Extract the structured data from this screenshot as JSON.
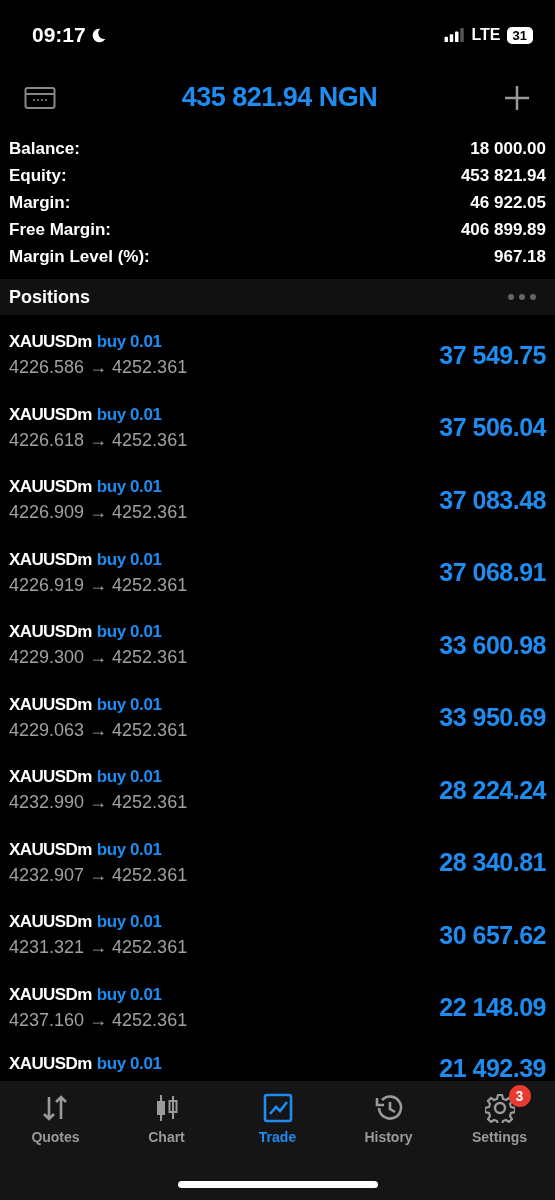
{
  "status_bar": {
    "time": "09:17",
    "network": "LTE",
    "battery": "31"
  },
  "header": {
    "title": "435 821.94 NGN"
  },
  "summary": [
    {
      "label": "Balance:",
      "value": "18 000.00"
    },
    {
      "label": "Equity:",
      "value": "453 821.94"
    },
    {
      "label": "Margin:",
      "value": "46 922.05"
    },
    {
      "label": "Free Margin:",
      "value": "406 899.89"
    },
    {
      "label": "Margin Level (%):",
      "value": "967.18"
    }
  ],
  "positions_header": {
    "title": "Positions"
  },
  "positions": [
    {
      "symbol": "XAUUSDm",
      "order": "buy 0.01",
      "prices": "4226.586 → 4252.361",
      "profit": "37 549.75"
    },
    {
      "symbol": "XAUUSDm",
      "order": "buy 0.01",
      "prices": "4226.618 → 4252.361",
      "profit": "37 506.04"
    },
    {
      "symbol": "XAUUSDm",
      "order": "buy 0.01",
      "prices": "4226.909 → 4252.361",
      "profit": "37 083.48"
    },
    {
      "symbol": "XAUUSDm",
      "order": "buy 0.01",
      "prices": "4226.919 → 4252.361",
      "profit": "37 068.91"
    },
    {
      "symbol": "XAUUSDm",
      "order": "buy 0.01",
      "prices": "4229.300 → 4252.361",
      "profit": "33 600.98"
    },
    {
      "symbol": "XAUUSDm",
      "order": "buy 0.01",
      "prices": "4229.063 → 4252.361",
      "profit": "33 950.69"
    },
    {
      "symbol": "XAUUSDm",
      "order": "buy 0.01",
      "prices": "4232.990 → 4252.361",
      "profit": "28 224.24"
    },
    {
      "symbol": "XAUUSDm",
      "order": "buy 0.01",
      "prices": "4232.907 → 4252.361",
      "profit": "28 340.81"
    },
    {
      "symbol": "XAUUSDm",
      "order": "buy 0.01",
      "prices": "4231.321 → 4252.361",
      "profit": "30 657.62"
    },
    {
      "symbol": "XAUUSDm",
      "order": "buy 0.01",
      "prices": "4237.160 → 4252.361",
      "profit": "22 148.09"
    },
    {
      "symbol": "XAUUSDm",
      "order": "buy 0.01",
      "profit": "21 492.39"
    }
  ],
  "tab_bar": [
    {
      "kind": "quotes",
      "label": "Quotes",
      "selected": false
    },
    {
      "kind": "chart",
      "label": "Chart",
      "selected": false
    },
    {
      "kind": "trade",
      "label": "Trade",
      "selected": true
    },
    {
      "kind": "history",
      "label": "History",
      "selected": false
    },
    {
      "kind": "settings",
      "label": "Settings",
      "selected": false,
      "badge": "3"
    }
  ]
}
